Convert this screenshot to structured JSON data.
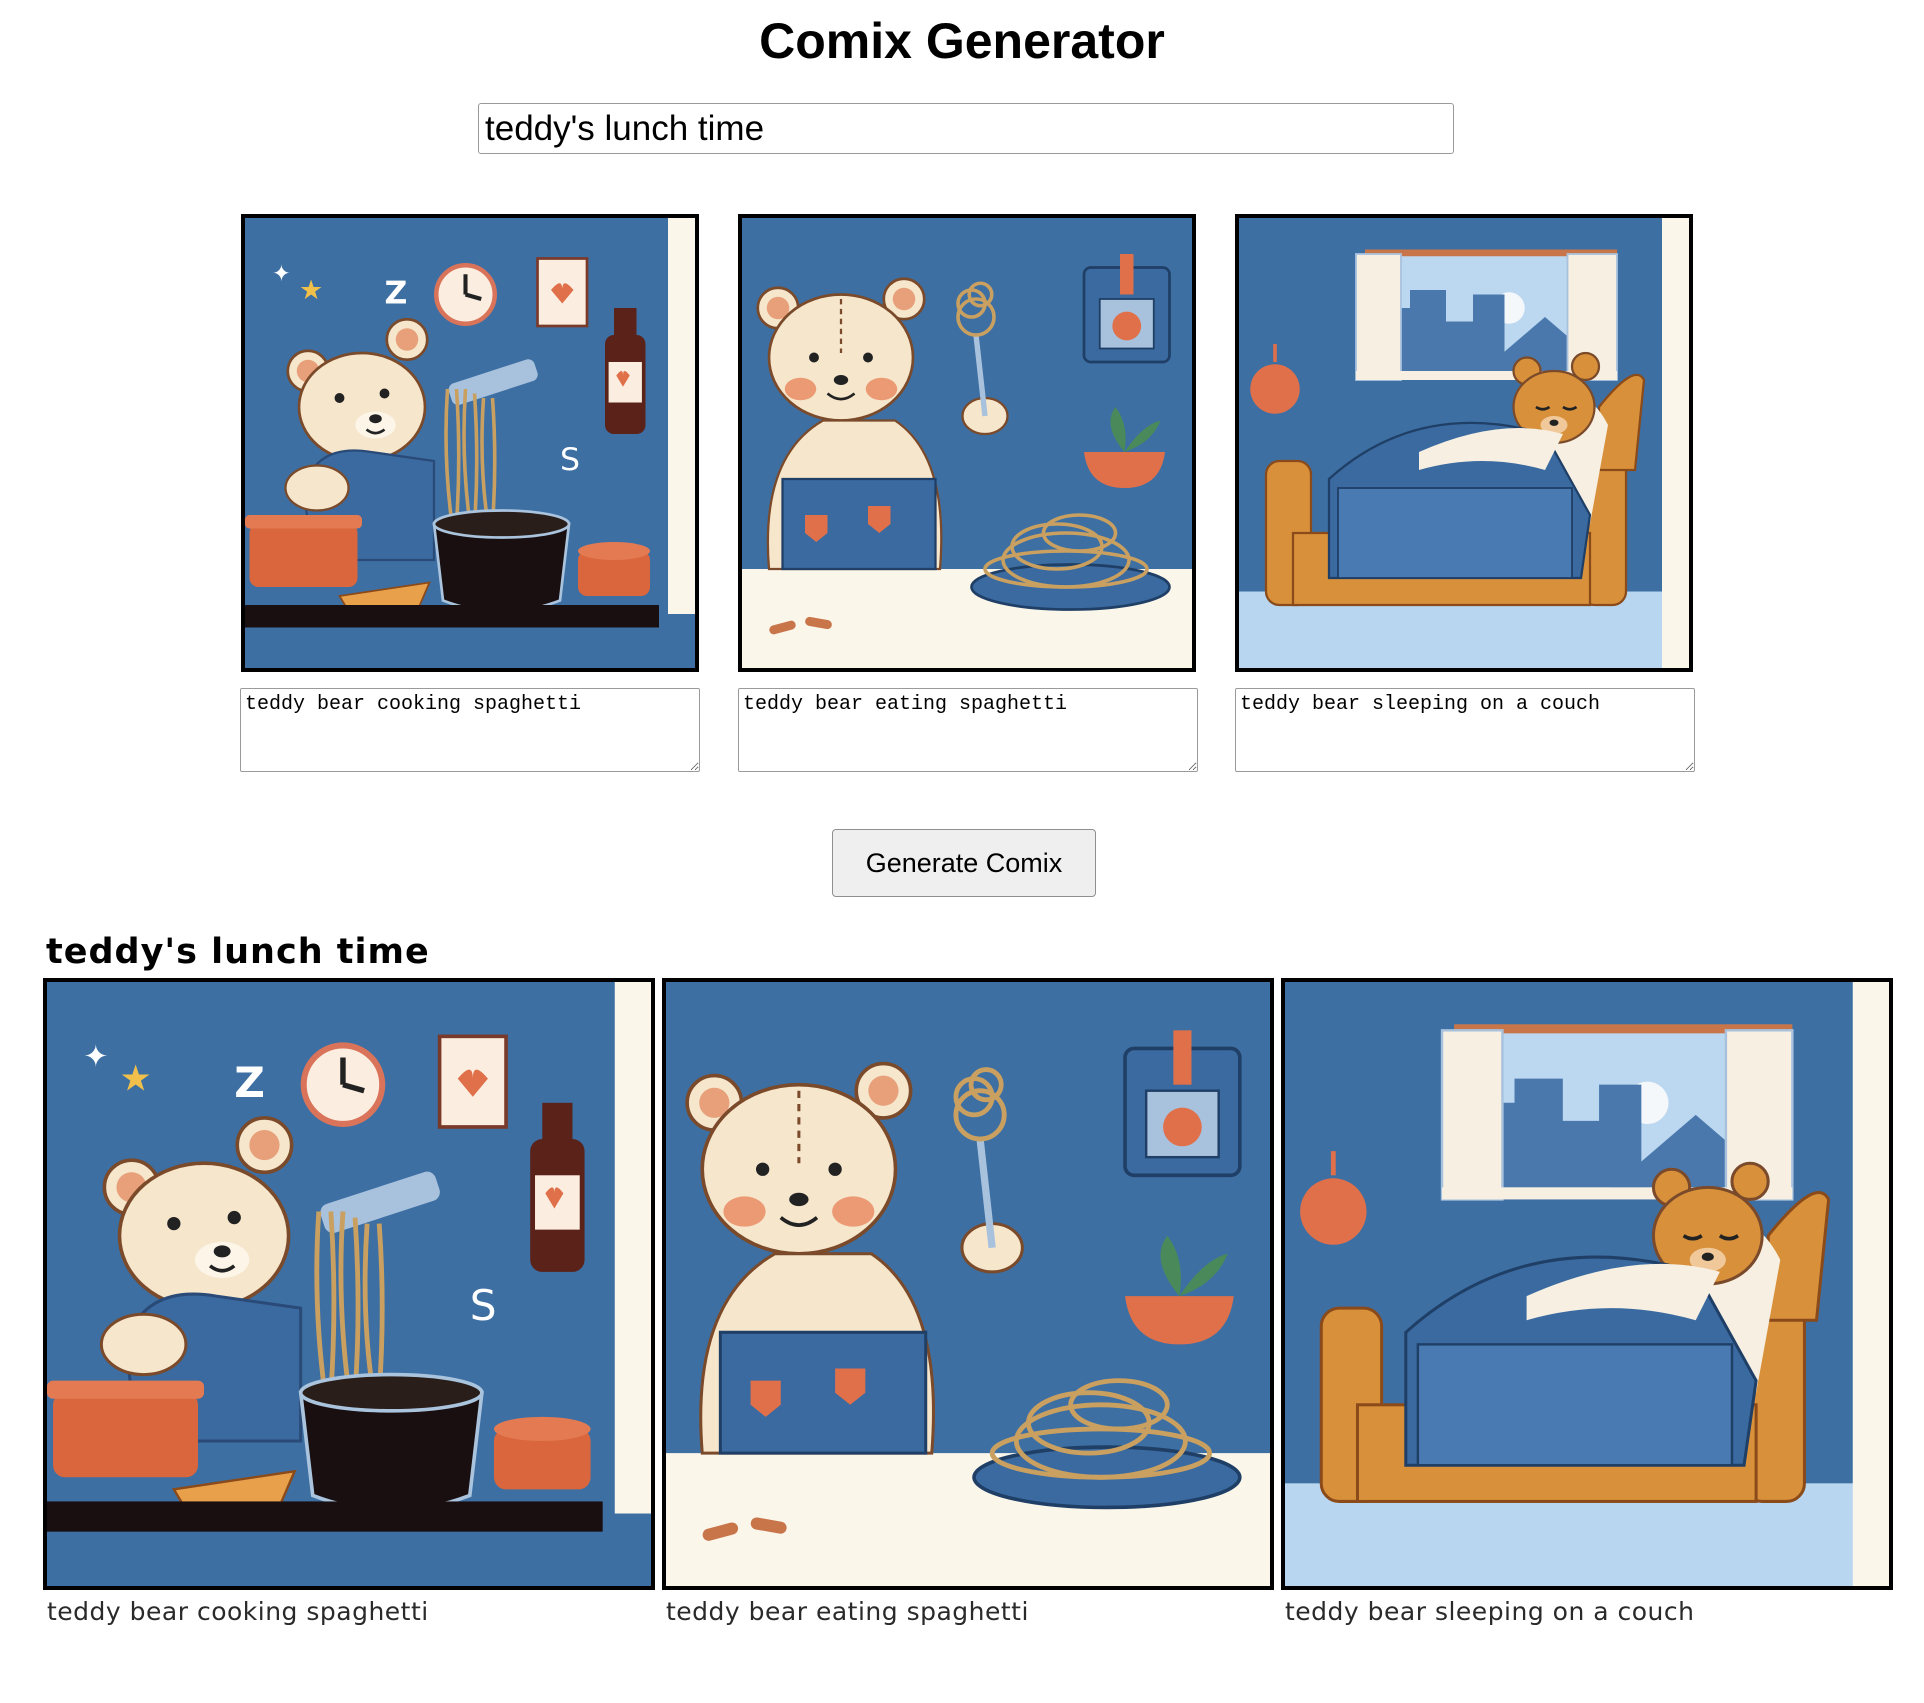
{
  "app": {
    "title": "Comix Generator"
  },
  "form": {
    "comic_title_value": "teddy's lunch time",
    "panels": [
      {
        "description": "teddy bear cooking spaghetti",
        "image_icon": "cooking-scene-image"
      },
      {
        "description": "teddy bear eating spaghetti",
        "image_icon": "eating-scene-image"
      },
      {
        "description": "teddy bear sleeping on a couch",
        "image_icon": "sleeping-scene-image"
      }
    ],
    "generate_label": "Generate Comix"
  },
  "comic": {
    "title": "teddy's lunch time",
    "panels": [
      {
        "caption": "teddy bear cooking spaghetti"
      },
      {
        "caption": "teddy bear eating spaghetti"
      },
      {
        "caption": "teddy bear sleeping on a couch"
      }
    ]
  },
  "colors": {
    "panel_background": "#3d6fa3",
    "bear_fur": "#f6e6cc",
    "accent_orange": "#e0704a",
    "button_background": "#efefef"
  }
}
